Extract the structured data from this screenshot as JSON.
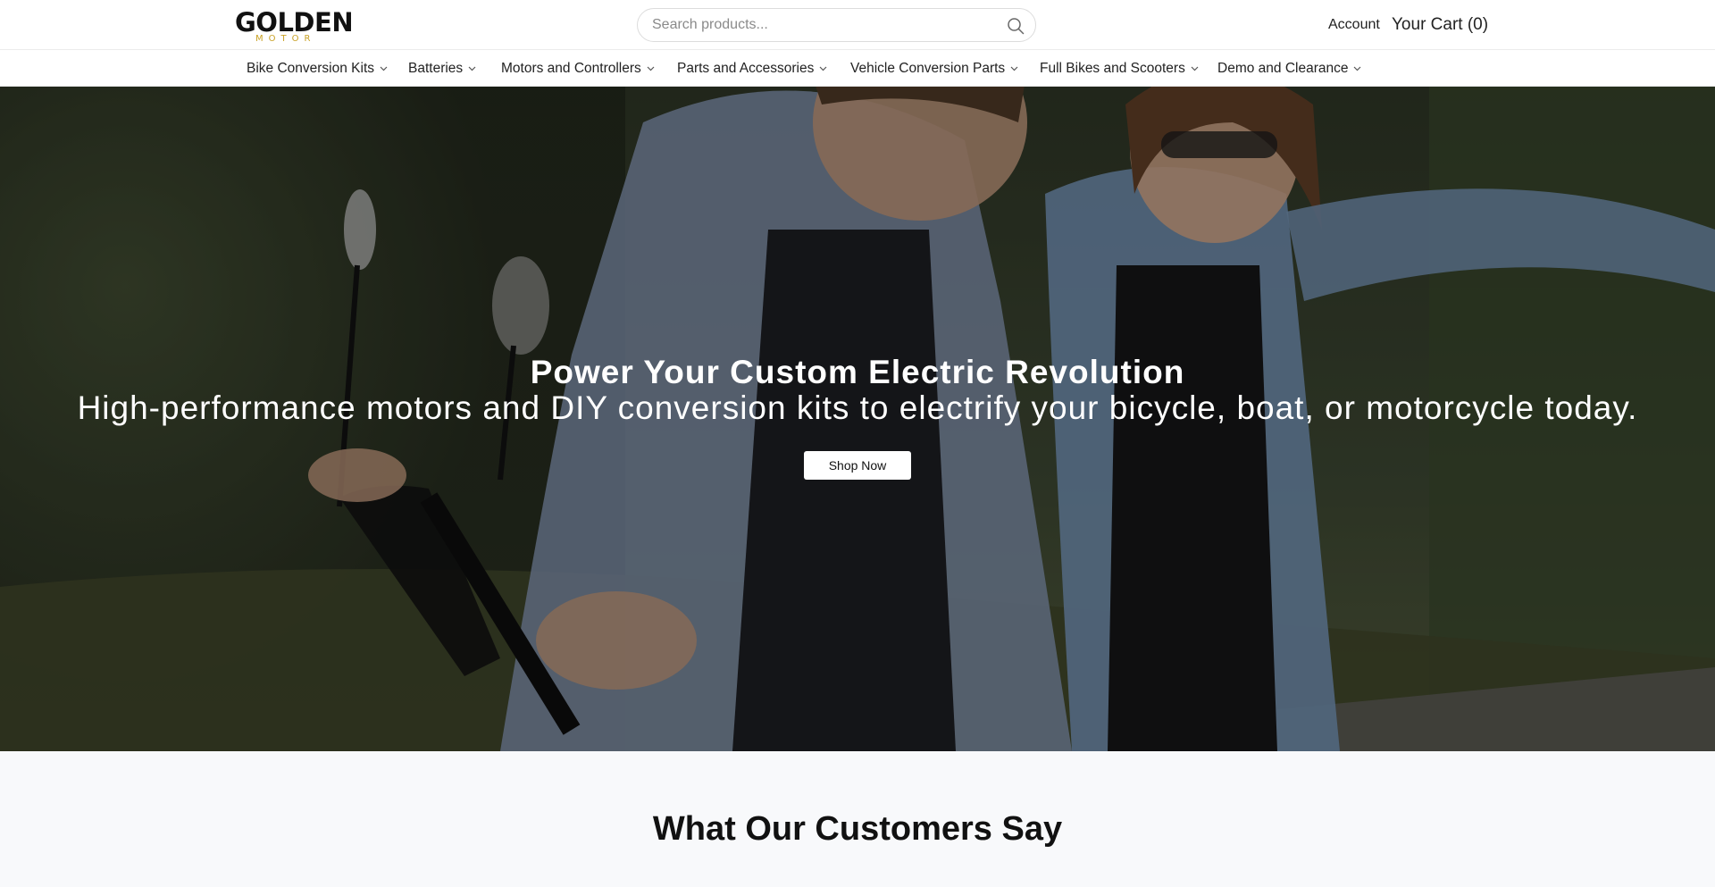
{
  "header": {
    "logo": {
      "text": "GOLDEN",
      "subtext": "MOTOR"
    },
    "search": {
      "placeholder": "Search products..."
    },
    "account_label": "Account",
    "cart_label": "Your Cart (0)"
  },
  "nav": {
    "items": [
      {
        "label": "Bike Conversion Kits"
      },
      {
        "label": "Batteries"
      },
      {
        "label": "Motors and Controllers"
      },
      {
        "label": "Parts and Accessories"
      },
      {
        "label": "Vehicle Conversion Parts"
      },
      {
        "label": "Full Bikes and Scooters"
      },
      {
        "label": "Demo and Clearance"
      }
    ]
  },
  "hero": {
    "title": "Power Your Custom Electric Revolution",
    "subtitle": "High-performance motors and DIY conversion kits to electrify your bicycle, boat, or motorcycle today.",
    "cta_label": "Shop Now"
  },
  "testimonials": {
    "title": "What Our Customers Say"
  },
  "colors": {
    "brand_gold": "#c9a227",
    "text_dark": "#111111",
    "section_bg": "#f8f9fb"
  },
  "icons": {
    "search": "search-icon",
    "dropdown": "chevron-down-icon"
  }
}
